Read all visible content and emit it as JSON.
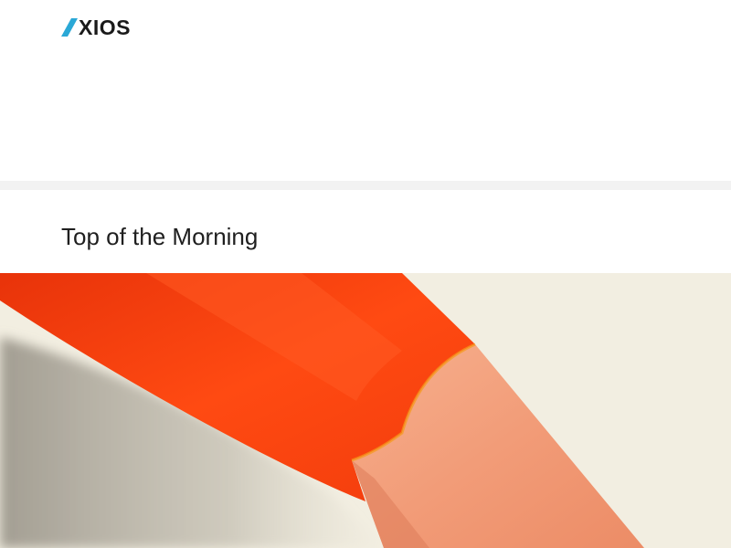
{
  "header": {
    "logo": {
      "icon": "axios-logo-mark-icon",
      "text": "XIOS",
      "accent_color": "#2aa8d6",
      "text_color": "#1a1a1a"
    }
  },
  "section": {
    "title": "Top of the Morning"
  },
  "hero_image": {
    "icon": "orange-pencil-illustration",
    "background_color": "#f2eee1",
    "pencil_color": "#ff4a12",
    "wood_color": "#f29c78"
  }
}
